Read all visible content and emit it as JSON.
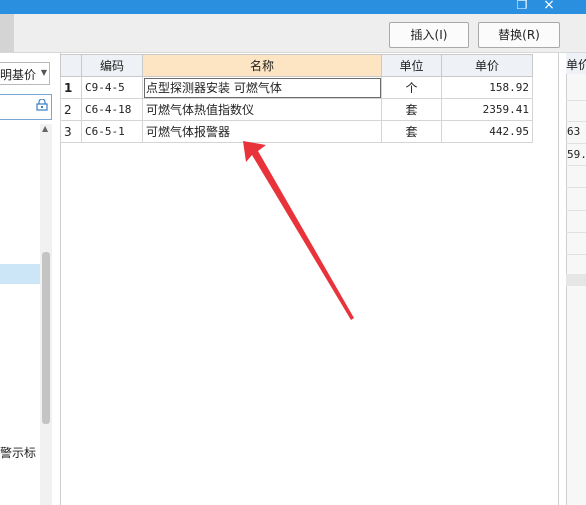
{
  "window": {
    "restore_glyph": "❐",
    "close_glyph": "×"
  },
  "toolbar": {
    "insert_label": "插入(I)",
    "replace_label": "替换(R)"
  },
  "left_panel": {
    "select_value": "明基价",
    "bottom_label": "警示标"
  },
  "table": {
    "columns": [
      "编码",
      "名称",
      "单位",
      "单价"
    ],
    "rows": [
      {
        "index": "1",
        "code": "C9-4-5",
        "name": "点型探测器安装 可燃气体",
        "unit": "个",
        "price": "158.92"
      },
      {
        "index": "2",
        "code": "C6-4-18",
        "name": "可燃气体热值指数仪",
        "unit": "套",
        "price": "2359.41"
      },
      {
        "index": "3",
        "code": "C6-5-1",
        "name": "可燃气体报警器",
        "unit": "套",
        "price": "442.95"
      }
    ]
  },
  "right_panel": {
    "header": "单价",
    "values": [
      "63",
      "59."
    ]
  },
  "annotation": {
    "arrow_color": "#e8333a"
  }
}
